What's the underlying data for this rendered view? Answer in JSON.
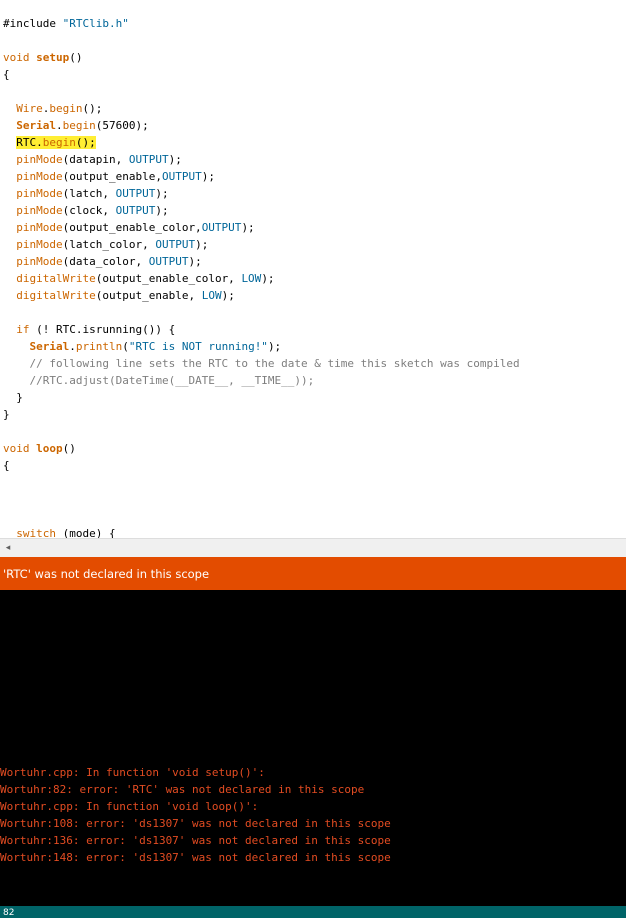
{
  "editor": {
    "lines": [
      {
        "tokens": [
          {
            "t": "#include ",
            "c": "plain"
          },
          {
            "t": "\"RTClib.h\"",
            "c": "str"
          }
        ]
      },
      {
        "tokens": []
      },
      {
        "tokens": [
          {
            "t": "void ",
            "c": "kw"
          },
          {
            "t": "setup",
            "c": "kwb"
          },
          {
            "t": "()",
            "c": "plain"
          }
        ]
      },
      {
        "tokens": [
          {
            "t": "{",
            "c": "plain"
          }
        ]
      },
      {
        "tokens": []
      },
      {
        "tokens": [
          {
            "t": "  ",
            "c": "plain"
          },
          {
            "t": "Wire",
            "c": "kw"
          },
          {
            "t": ".",
            "c": "plain"
          },
          {
            "t": "begin",
            "c": "kw"
          },
          {
            "t": "();",
            "c": "plain"
          }
        ]
      },
      {
        "tokens": [
          {
            "t": "  ",
            "c": "plain"
          },
          {
            "t": "Serial",
            "c": "kwb"
          },
          {
            "t": ".",
            "c": "plain"
          },
          {
            "t": "begin",
            "c": "kw"
          },
          {
            "t": "(57600);",
            "c": "plain"
          }
        ]
      },
      {
        "highlight": true,
        "tokens": [
          {
            "t": "  ",
            "c": "plain"
          },
          {
            "t": "RTC.",
            "c": "plain",
            "hl": true
          },
          {
            "t": "begin",
            "c": "kw",
            "hl": true
          },
          {
            "t": "();",
            "c": "plain",
            "hl": true
          }
        ]
      },
      {
        "tokens": [
          {
            "t": "  ",
            "c": "plain"
          },
          {
            "t": "pinMode",
            "c": "kw"
          },
          {
            "t": "(datapin, ",
            "c": "plain"
          },
          {
            "t": "OUTPUT",
            "c": "const"
          },
          {
            "t": ");",
            "c": "plain"
          }
        ]
      },
      {
        "tokens": [
          {
            "t": "  ",
            "c": "plain"
          },
          {
            "t": "pinMode",
            "c": "kw"
          },
          {
            "t": "(output_enable,",
            "c": "plain"
          },
          {
            "t": "OUTPUT",
            "c": "const"
          },
          {
            "t": ");",
            "c": "plain"
          }
        ]
      },
      {
        "tokens": [
          {
            "t": "  ",
            "c": "plain"
          },
          {
            "t": "pinMode",
            "c": "kw"
          },
          {
            "t": "(latch, ",
            "c": "plain"
          },
          {
            "t": "OUTPUT",
            "c": "const"
          },
          {
            "t": ");",
            "c": "plain"
          }
        ]
      },
      {
        "tokens": [
          {
            "t": "  ",
            "c": "plain"
          },
          {
            "t": "pinMode",
            "c": "kw"
          },
          {
            "t": "(clock, ",
            "c": "plain"
          },
          {
            "t": "OUTPUT",
            "c": "const"
          },
          {
            "t": ");",
            "c": "plain"
          }
        ]
      },
      {
        "tokens": [
          {
            "t": "  ",
            "c": "plain"
          },
          {
            "t": "pinMode",
            "c": "kw"
          },
          {
            "t": "(output_enable_color,",
            "c": "plain"
          },
          {
            "t": "OUTPUT",
            "c": "const"
          },
          {
            "t": ");",
            "c": "plain"
          }
        ]
      },
      {
        "tokens": [
          {
            "t": "  ",
            "c": "plain"
          },
          {
            "t": "pinMode",
            "c": "kw"
          },
          {
            "t": "(latch_color, ",
            "c": "plain"
          },
          {
            "t": "OUTPUT",
            "c": "const"
          },
          {
            "t": ");",
            "c": "plain"
          }
        ]
      },
      {
        "tokens": [
          {
            "t": "  ",
            "c": "plain"
          },
          {
            "t": "pinMode",
            "c": "kw"
          },
          {
            "t": "(data_color, ",
            "c": "plain"
          },
          {
            "t": "OUTPUT",
            "c": "const"
          },
          {
            "t": ");",
            "c": "plain"
          }
        ]
      },
      {
        "tokens": [
          {
            "t": "  ",
            "c": "plain"
          },
          {
            "t": "digitalWrite",
            "c": "kw"
          },
          {
            "t": "(output_enable_color, ",
            "c": "plain"
          },
          {
            "t": "LOW",
            "c": "const"
          },
          {
            "t": ");",
            "c": "plain"
          }
        ]
      },
      {
        "tokens": [
          {
            "t": "  ",
            "c": "plain"
          },
          {
            "t": "digitalWrite",
            "c": "kw"
          },
          {
            "t": "(output_enable, ",
            "c": "plain"
          },
          {
            "t": "LOW",
            "c": "const"
          },
          {
            "t": ");",
            "c": "plain"
          }
        ]
      },
      {
        "tokens": []
      },
      {
        "tokens": [
          {
            "t": "  ",
            "c": "plain"
          },
          {
            "t": "if",
            "c": "kw"
          },
          {
            "t": " (! RTC.isrunning()) {",
            "c": "plain"
          }
        ]
      },
      {
        "tokens": [
          {
            "t": "    ",
            "c": "plain"
          },
          {
            "t": "Serial",
            "c": "kwb"
          },
          {
            "t": ".",
            "c": "plain"
          },
          {
            "t": "println",
            "c": "kw"
          },
          {
            "t": "(",
            "c": "plain"
          },
          {
            "t": "\"RTC is NOT running!\"",
            "c": "str"
          },
          {
            "t": ");",
            "c": "plain"
          }
        ]
      },
      {
        "tokens": [
          {
            "t": "    ",
            "c": "plain"
          },
          {
            "t": "// following line sets the RTC to the date & time this sketch was compiled",
            "c": "cmt"
          }
        ]
      },
      {
        "tokens": [
          {
            "t": "    ",
            "c": "plain"
          },
          {
            "t": "//RTC.adjust(DateTime(__DATE__, __TIME__));",
            "c": "cmt"
          }
        ]
      },
      {
        "tokens": [
          {
            "t": "  }",
            "c": "plain"
          }
        ]
      },
      {
        "tokens": [
          {
            "t": "}",
            "c": "plain"
          }
        ]
      },
      {
        "tokens": []
      },
      {
        "tokens": [
          {
            "t": "void ",
            "c": "kw"
          },
          {
            "t": "loop",
            "c": "kwb"
          },
          {
            "t": "()",
            "c": "plain"
          }
        ]
      },
      {
        "tokens": [
          {
            "t": "{",
            "c": "plain"
          }
        ]
      },
      {
        "tokens": []
      },
      {
        "tokens": []
      },
      {
        "tokens": []
      },
      {
        "tokens": [
          {
            "t": "  ",
            "c": "plain"
          },
          {
            "t": "switch",
            "c": "kw"
          },
          {
            "t": " (mode) {",
            "c": "plain"
          }
        ]
      }
    ]
  },
  "scrollbar": {
    "left_arrow": "◂"
  },
  "status": {
    "message": "'RTC' was not declared in this scope"
  },
  "console": {
    "lines": [
      "Wortuhr.cpp: In function 'void setup()':",
      "Wortuhr:82: error: 'RTC' was not declared in this scope",
      "Wortuhr.cpp: In function 'void loop()':",
      "Wortuhr:108: error: 'ds1307' was not declared in this scope",
      "Wortuhr:136: error: 'ds1307' was not declared in this scope",
      "Wortuhr:148: error: 'ds1307' was not declared in this scope"
    ]
  },
  "footer": {
    "line_number": "82"
  },
  "colors": {
    "keyword": "#cc6600",
    "constant": "#006699",
    "comment": "#7e7e7e",
    "highlight": "#ffee33",
    "status_bar": "#e34c00",
    "console_text": "#e34c22",
    "footer": "#006468"
  }
}
